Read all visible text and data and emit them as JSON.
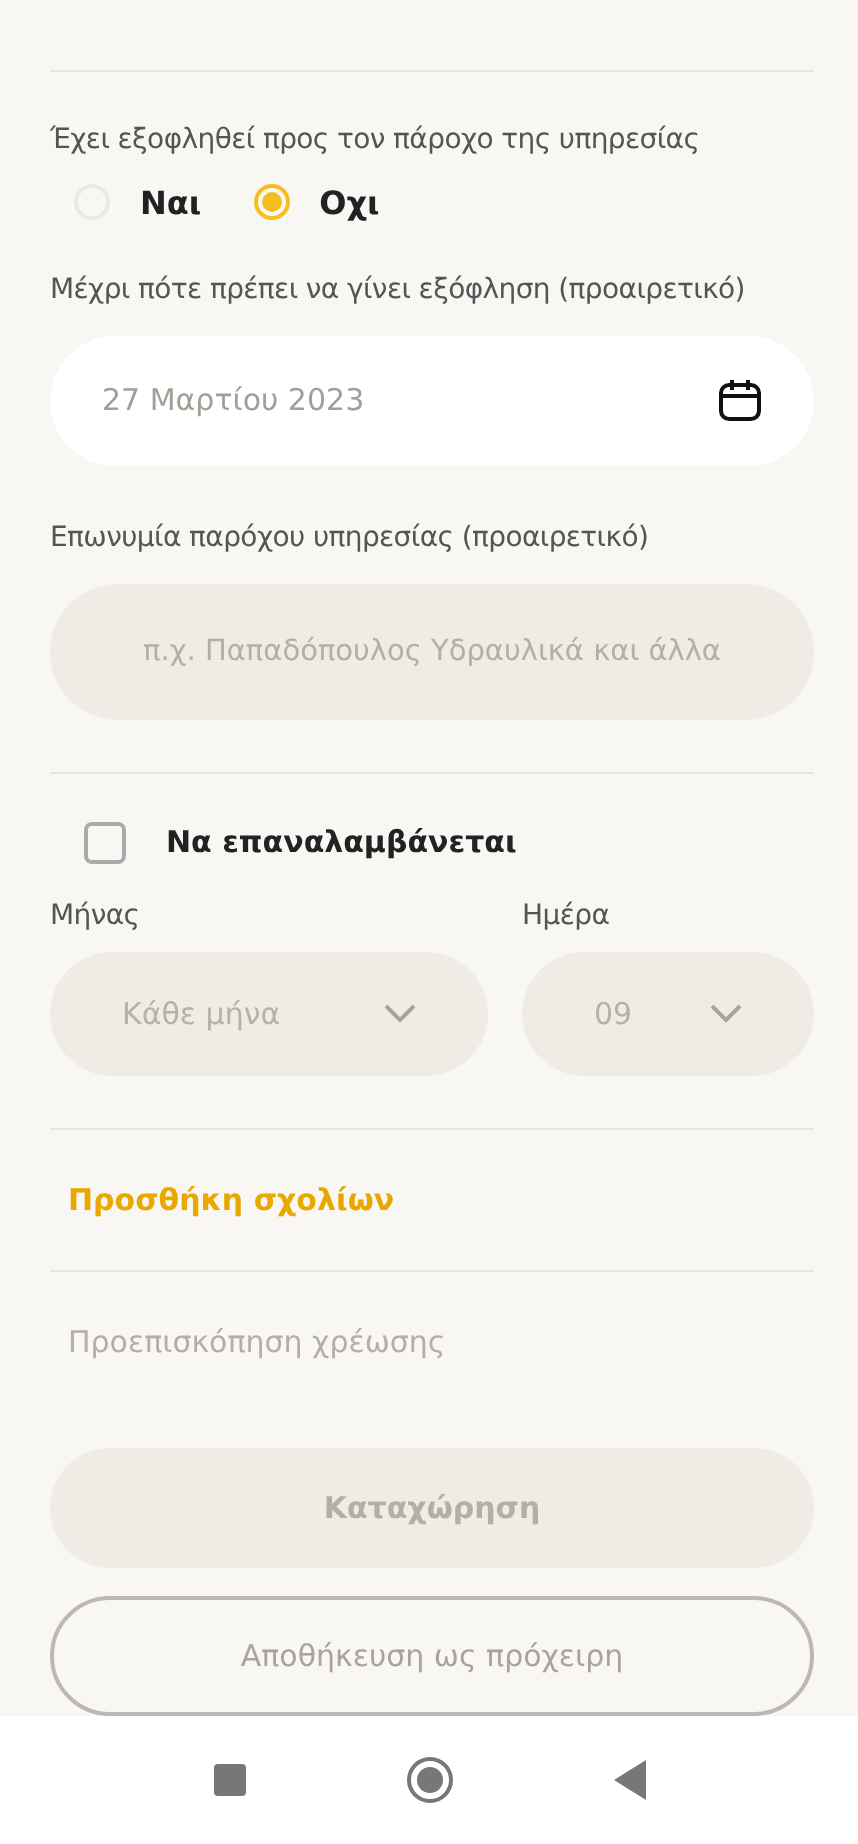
{
  "paid_question": {
    "label": "Έχει εξοφληθεί προς τον πάροχο της υπηρεσίας",
    "options": [
      {
        "label": "Ναι",
        "selected": false
      },
      {
        "label": "Οχι",
        "selected": true
      }
    ]
  },
  "due_date": {
    "label": "Μέχρι πότε πρέπει να γίνει εξόφληση (προαιρετικό)",
    "value": "27 Μαρτίου 2023"
  },
  "provider": {
    "label": "Επωνυμία παρόχου υπηρεσίας (προαιρετικό)",
    "placeholder": "π.χ. Παπαδόπουλος Υδραυλικά και άλλα"
  },
  "repeat": {
    "label": "Να επαναλαμβάνεται",
    "checked": false
  },
  "month": {
    "label": "Μήνας",
    "value": "Κάθε μήνα",
    "disabled": true
  },
  "day": {
    "label": "Ημέρα",
    "value": "09",
    "disabled": true
  },
  "add_comments": "Προσθήκη σχολίων",
  "charge_preview": "Προεπισκόπηση χρέωσης",
  "submit": {
    "label": "Καταχώρηση",
    "disabled": true
  },
  "save_draft": {
    "label": "Αποθήκευση ως πρόχειρη",
    "disabled": true
  }
}
